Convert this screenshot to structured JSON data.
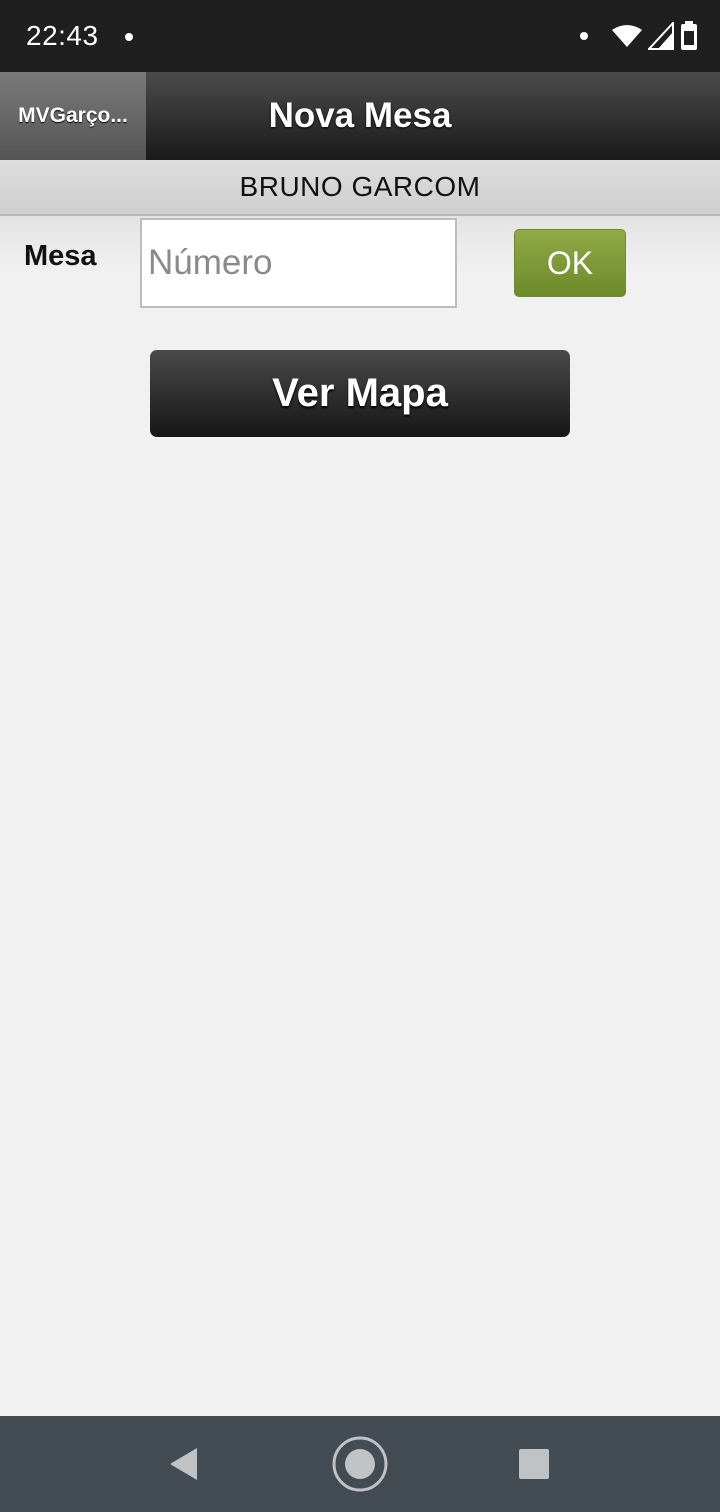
{
  "status_bar": {
    "time": "22:43"
  },
  "action_bar": {
    "back_label": "MVGarço...",
    "title": "Nova Mesa"
  },
  "subheader": {
    "user": "BRUNO GARCOM"
  },
  "form": {
    "mesa_label": "Mesa",
    "mesa_placeholder": "Número",
    "mesa_value": "",
    "ok_label": "OK"
  },
  "map_button": {
    "label": "Ver Mapa"
  },
  "colors": {
    "ok_green": "#7f9838",
    "nav_bar": "#434b53",
    "status_bar": "#1f1f1f"
  },
  "nav_icons": [
    "back-icon",
    "home-icon",
    "recents-icon"
  ]
}
